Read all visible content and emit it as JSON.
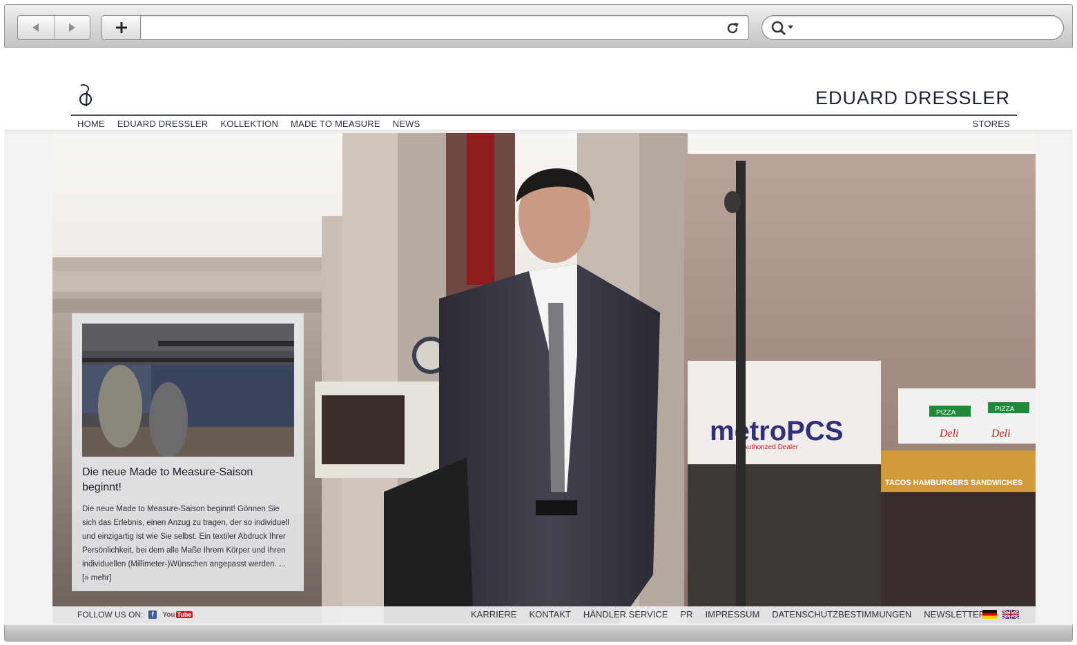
{
  "browser": {
    "url": "",
    "search_query": ""
  },
  "site": {
    "brand": "EDUARD DRESSLER",
    "nav": [
      {
        "label": "HOME"
      },
      {
        "label": "EDUARD DRESSLER"
      },
      {
        "label": "KOLLEKTION"
      },
      {
        "label": "MADE TO MEASURE"
      },
      {
        "label": "NEWS"
      }
    ],
    "stores_label": "STORES"
  },
  "news": {
    "title": "Die neue Made to Measure-Saison beginnt!",
    "text": "Die neue Made to Measure-Saison beginnt! Gönnen Sie sich das Erlebnis, einen Anzug zu tragen, der so individuell und einzigartig ist wie Sie selbst. Ein textiler Abdruck Ihrer Persönlichkeit, bei dem alle Maße Ihrem Körper und Ihren individuellen (Millimeter-)Wünschen angepasst werden. ...",
    "more_label": "[» mehr]"
  },
  "hero_signs": {
    "store": "metroPCS",
    "store_sub": "Authorized Dealer",
    "deli_1": "Deli",
    "deli_2": "Deli",
    "pizza_1": "PIZZA",
    "pizza_2": "PIZZA",
    "shop_banner": "TACOS HAMBURGERS SANDWICHES"
  },
  "footer": {
    "follow_label": "FOLLOW US ON:",
    "facebook_icon": "f",
    "youtube_you": "You",
    "youtube_tube": "Tube",
    "links": [
      {
        "label": "KARRIERE"
      },
      {
        "label": "KONTAKT"
      },
      {
        "label": "HÄNDLER SERVICE"
      },
      {
        "label": "PR"
      },
      {
        "label": "IMPRESSUM"
      },
      {
        "label": "DATENSCHUTZBESTIMMUNGEN"
      },
      {
        "label": "NEWSLETTER"
      }
    ]
  },
  "icons": {
    "back": "back-arrow-icon",
    "forward": "forward-arrow-icon",
    "add": "plus-icon",
    "reload": "reload-icon",
    "search": "search-icon"
  },
  "colors": {
    "brand_text": "#1e2233",
    "chrome": "#d6d6d6"
  }
}
